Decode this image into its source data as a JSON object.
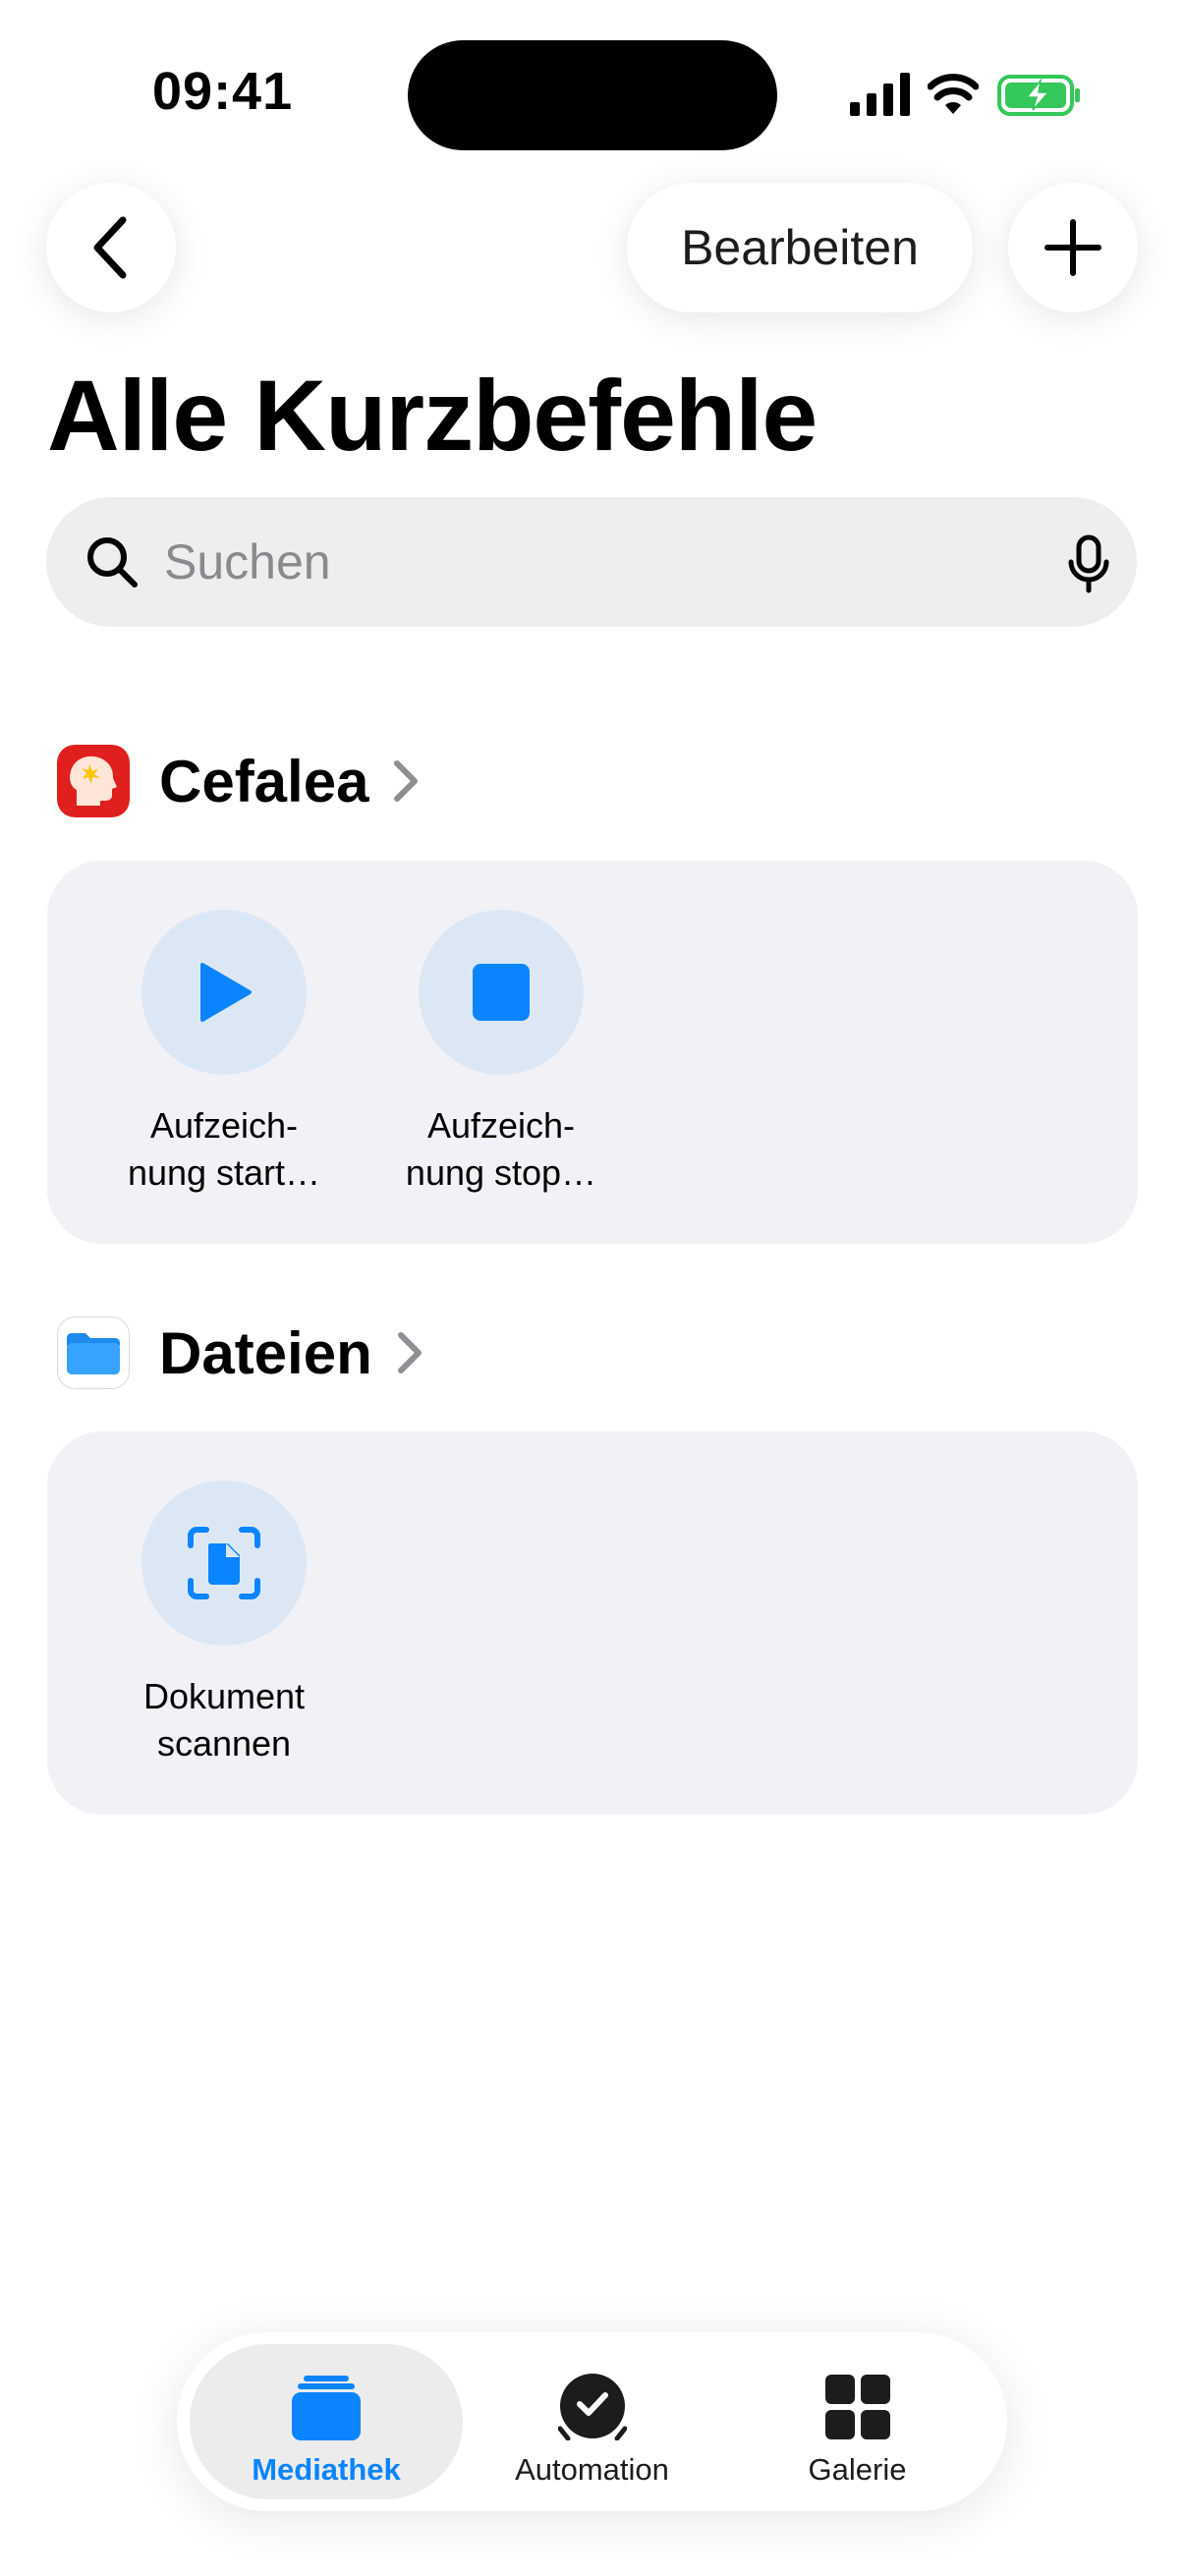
{
  "status_bar": {
    "time": "09:41"
  },
  "nav": {
    "edit_label": "Bearbeiten"
  },
  "page": {
    "title": "Alle Kurzbefehle"
  },
  "search": {
    "placeholder": "Suchen"
  },
  "sections": [
    {
      "title": "Cefalea",
      "icon": "head-app-icon",
      "actions": [
        {
          "label": "Aufzeich-\nnung start…",
          "icon": "play-icon"
        },
        {
          "label": "Aufzeich-\nnung stop…",
          "icon": "stop-icon"
        }
      ]
    },
    {
      "title": "Dateien",
      "icon": "files-app-icon",
      "actions": [
        {
          "label": "Dokument\nscannen",
          "icon": "document-scan-icon"
        }
      ]
    }
  ],
  "tabs": [
    {
      "label": "Mediathek",
      "icon": "library-stack-icon",
      "selected": true
    },
    {
      "label": "Automation",
      "icon": "automation-check-icon",
      "selected": false
    },
    {
      "label": "Galerie",
      "icon": "gallery-grid-icon",
      "selected": false
    }
  ],
  "colors": {
    "accent": "#0a84ff",
    "card": "#f1f1f6",
    "action_circle": "#dce7f6",
    "battery_green": "#34c759"
  }
}
